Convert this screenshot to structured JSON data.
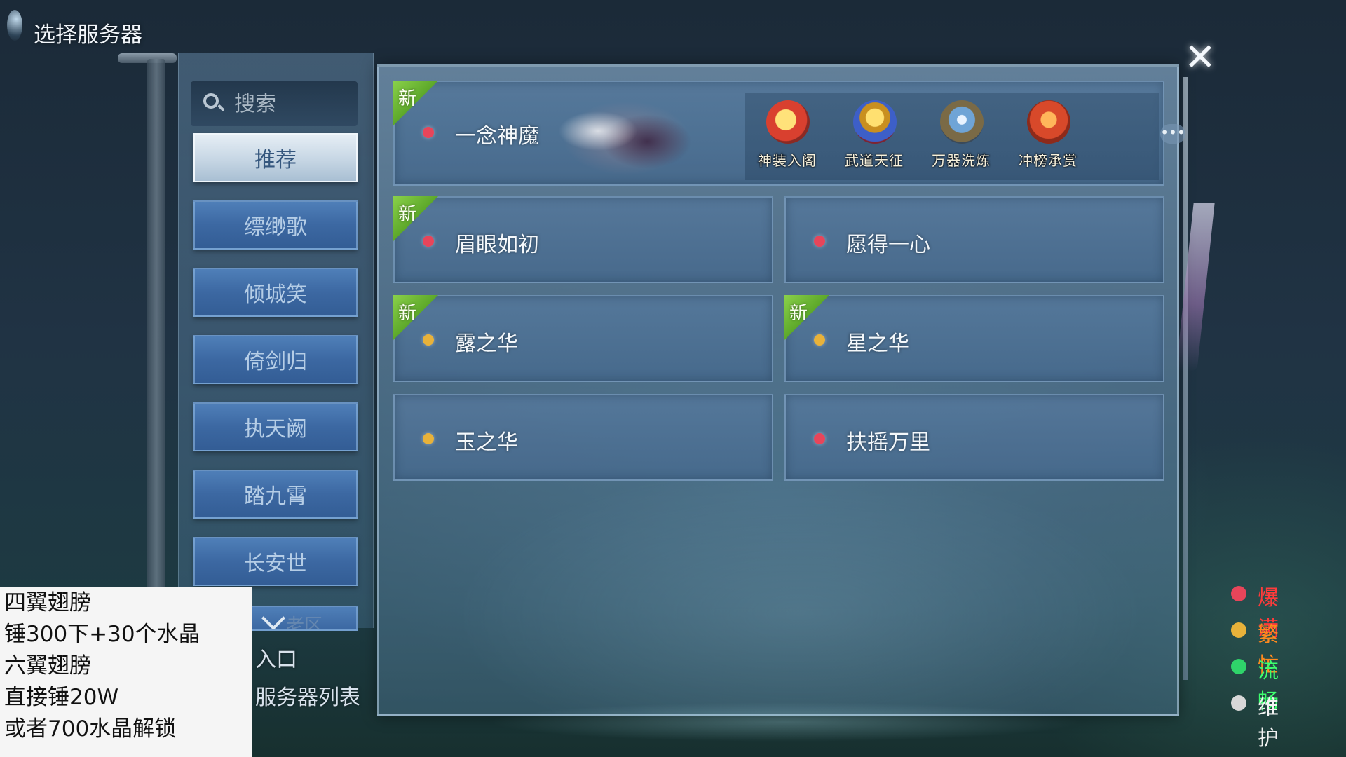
{
  "header": {
    "title": "选择服务器",
    "close_icon": "✕"
  },
  "search": {
    "placeholder": "搜索"
  },
  "sidebar": {
    "categories": [
      {
        "label": "推荐",
        "active": true
      },
      {
        "label": "缥缈歌",
        "active": false
      },
      {
        "label": "倾城笑",
        "active": false
      },
      {
        "label": "倚剑归",
        "active": false
      },
      {
        "label": "执天阙",
        "active": false
      },
      {
        "label": "踏九霄",
        "active": false
      },
      {
        "label": "长安世",
        "active": false
      }
    ],
    "more_label": "老区",
    "links": [
      "入口",
      "服务器列表"
    ]
  },
  "servers": {
    "new_tag": "新",
    "featured": {
      "name": "一念神魔",
      "status": "full",
      "is_new": true
    },
    "list": [
      {
        "name": "眉眼如初",
        "status": "full",
        "is_new": true
      },
      {
        "name": "愿得一心",
        "status": "full",
        "is_new": false
      },
      {
        "name": "露之华",
        "status": "busy",
        "is_new": true
      },
      {
        "name": "星之华",
        "status": "busy",
        "is_new": true
      },
      {
        "name": "玉之华",
        "status": "busy",
        "is_new": false
      },
      {
        "name": "扶摇万里",
        "status": "full",
        "is_new": false
      }
    ]
  },
  "events": [
    {
      "label": "神装入阁",
      "icon": "coin-emblem-icon"
    },
    {
      "label": "武道天征",
      "icon": "trophy-icon"
    },
    {
      "label": "万器洗炼",
      "icon": "weapons-icon"
    },
    {
      "label": "冲榜承赏",
      "icon": "ranking-banner-icon"
    }
  ],
  "events_more": "•••",
  "legend": [
    {
      "label": "爆满",
      "status": "full"
    },
    {
      "label": "繁忙",
      "status": "busy"
    },
    {
      "label": "流畅",
      "status": "smooth"
    },
    {
      "label": "维护",
      "status": "maintenance"
    }
  ],
  "status_colors": {
    "full": "#e8455a",
    "busy": "#e8b23a",
    "smooth": "#2fd46a",
    "maintenance": "#d8d8d8"
  },
  "legend_text_colors": {
    "full": "#ff3b3b",
    "busy": "#ff8a1e",
    "smooth": "#3dff6e",
    "maintenance": "#f2f2f2"
  },
  "overlay_note": {
    "lines": [
      "四翼翅膀",
      "锤300下+30个水晶",
      "六翼翅膀",
      "直接锤20W",
      "或者700水晶解锁"
    ]
  }
}
